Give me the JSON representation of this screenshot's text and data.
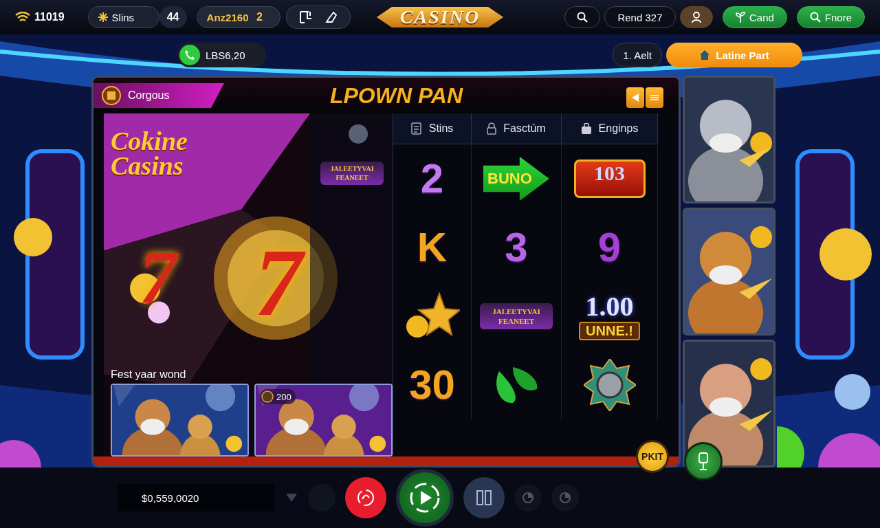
{
  "status": {
    "count": "11019"
  },
  "chips": [
    {
      "kind": "star",
      "label": "Slins",
      "count": "44"
    },
    {
      "kind": "gold",
      "label": "Anz2160",
      "count": "2"
    },
    {
      "kind": "tools"
    }
  ],
  "logo": "CASINO",
  "right_controls": [
    {
      "kind": "search"
    },
    {
      "kind": "text",
      "label": "Rend 327"
    },
    {
      "kind": "user"
    },
    {
      "kind": "green-plant",
      "label": "Cand"
    },
    {
      "kind": "green-search",
      "label": "Fnore"
    }
  ],
  "balance_pill": {
    "label": "LBS6,20"
  },
  "sub_buttons": [
    {
      "kind": "dark",
      "label": "1. Aelt"
    },
    {
      "kind": "orange",
      "label": "Latine Part"
    }
  ],
  "panel": {
    "tab": "Corgous",
    "title": "LPOWN PAN",
    "promo": {
      "title": [
        "Cokine",
        "Casins"
      ],
      "symbols": [
        "7",
        "7"
      ],
      "feature_badge": [
        "JALEETYVAI",
        "FEANEET"
      ],
      "caption": "Fest yaar wond",
      "thumbs": [
        {
          "kind": "picture"
        },
        {
          "kind": "picture",
          "badge": "200"
        }
      ]
    },
    "columns": [
      {
        "label": "Stins",
        "kind": "list",
        "cells": [
          {
            "kind": "glyph",
            "text": "2",
            "color": "#c27af2"
          },
          {
            "kind": "glyph",
            "text": "K",
            "color": "#f2a51f"
          },
          {
            "kind": "star"
          },
          {
            "kind": "glyph",
            "text": "30",
            "color": "#f2a51f"
          }
        ]
      },
      {
        "label": "Fasctúm",
        "kind": "lock",
        "cells": [
          {
            "kind": "arrow",
            "text": "BUNO"
          },
          {
            "kind": "glyph",
            "text": "3",
            "color": "#b565e6"
          },
          {
            "kind": "badge",
            "lines": [
              "JALEETYVAI",
              "FEANEET"
            ]
          },
          {
            "kind": "leaf"
          }
        ]
      },
      {
        "label": "Enginps",
        "kind": "bag",
        "cells": [
          {
            "kind": "plaque",
            "text": "103"
          },
          {
            "kind": "glyph",
            "text": "9",
            "color": "#a63fd6"
          },
          {
            "kind": "value",
            "text": "1.00",
            "sub": "UNNE.!"
          },
          {
            "kind": "medal"
          }
        ]
      }
    ]
  },
  "side_badges": [
    {
      "kind": "yellow",
      "label": "PKIT"
    },
    {
      "kind": "green"
    }
  ],
  "footer": {
    "balance": "$0,559,0020",
    "buttons": [
      {
        "kind": "triangle"
      },
      {
        "kind": "dim"
      },
      {
        "kind": "red"
      },
      {
        "kind": "play"
      },
      {
        "kind": "slate"
      },
      {
        "kind": "dark"
      },
      {
        "kind": "dark"
      }
    ]
  }
}
